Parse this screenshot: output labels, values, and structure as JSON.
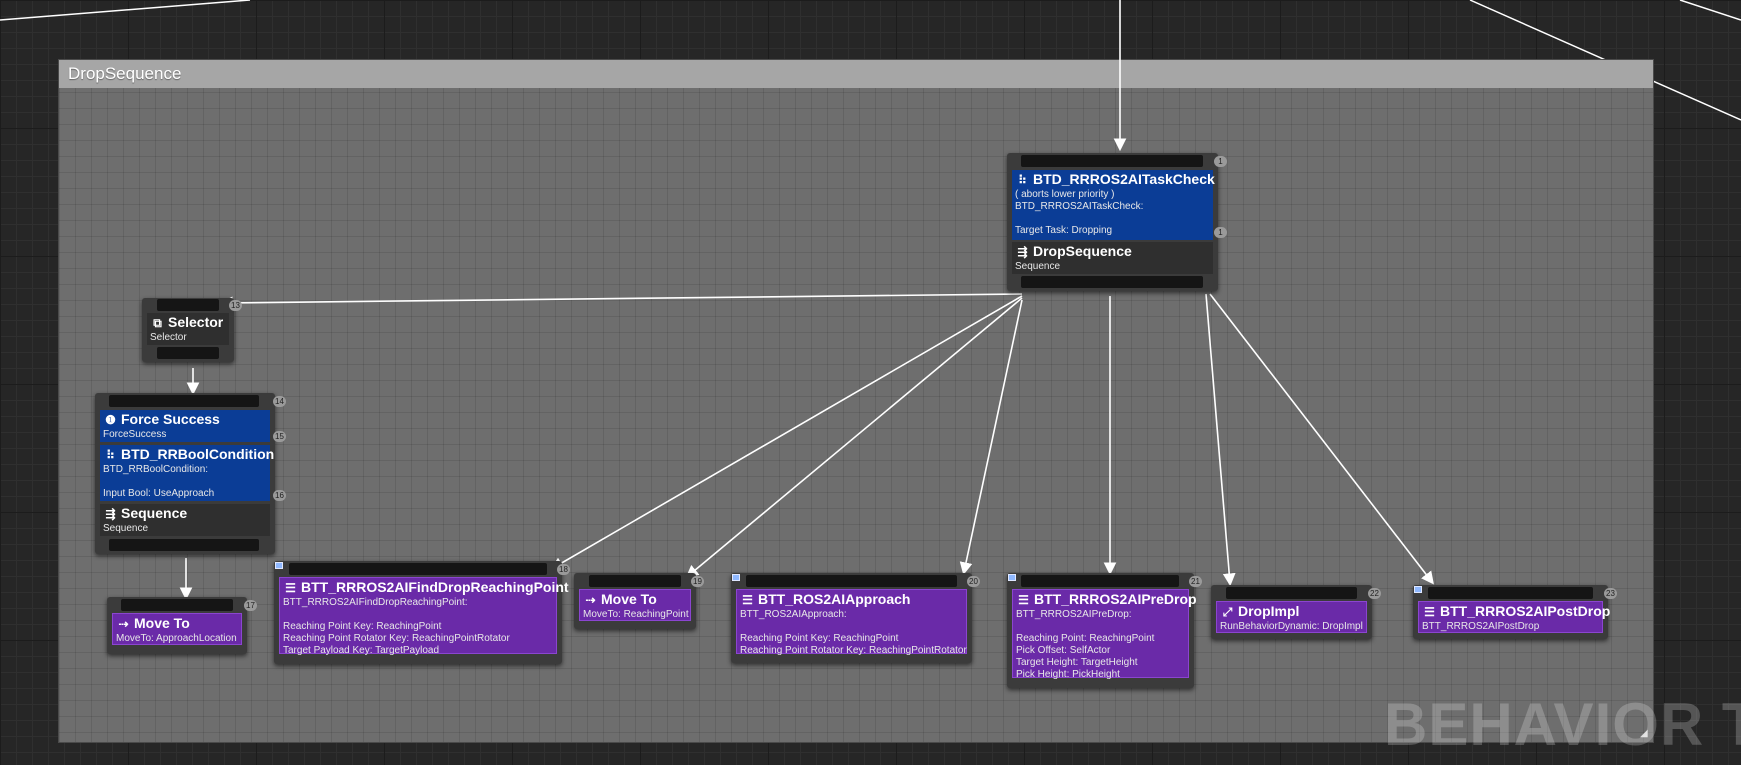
{
  "comment": {
    "title": "DropSequence"
  },
  "watermark": "BEHAVIOR TRE",
  "resize_grip": "◢",
  "colors": {
    "decorator": "#0b3d96",
    "task": "#6a2aa8",
    "composite": "#2f2f2f",
    "wire": "#ffffff"
  },
  "root": {
    "index": "1",
    "decorator": {
      "icon": "decorator-icon",
      "title": "BTD_RRROS2AITaskCheck",
      "lines": [
        "( aborts lower priority )",
        "BTD_RRROS2AITaskCheck:",
        "",
        "Target Task: Dropping"
      ],
      "index": "1"
    },
    "composite": {
      "icon": "sequence-icon",
      "title": "DropSequence",
      "subtitle": "Sequence"
    }
  },
  "selector": {
    "index": "13",
    "icon": "selector-icon",
    "title": "Selector",
    "subtitle": "Selector"
  },
  "approach_seq": {
    "index": "14",
    "dec1": {
      "title": "Force Success",
      "subtitle": "ForceSuccess",
      "index": "15"
    },
    "dec2": {
      "title": "BTD_RRBoolCondition",
      "lines": [
        "BTD_RRBoolCondition:",
        "",
        "Input Bool: UseApproach"
      ],
      "index": "16"
    },
    "composite": {
      "title": "Sequence",
      "subtitle": "Sequence"
    }
  },
  "moveto_approach": {
    "index": "17",
    "title": "Move To",
    "subtitle": "MoveTo: ApproachLocation"
  },
  "tasks": {
    "find": {
      "index": "18",
      "title": "BTT_RRROS2AIFindDropReachingPoint",
      "lines": [
        "BTT_RRROS2AIFindDropReachingPoint:",
        "",
        "Reaching Point Key: ReachingPoint",
        "Reaching Point Rotator Key: ReachingPointRotator",
        "Target Payload Key: TargetPayload"
      ]
    },
    "moveto": {
      "index": "19",
      "title": "Move To",
      "lines": [
        "MoveTo: ReachingPoint"
      ]
    },
    "approach": {
      "index": "20",
      "title": "BTT_ROS2AIApproach",
      "lines": [
        "BTT_ROS2AIApproach:",
        "",
        "Reaching Point Key: ReachingPoint",
        "Reaching Point Rotator Key: ReachingPointRotator"
      ]
    },
    "predrop": {
      "index": "21",
      "title": "BTT_RRROS2AIPreDrop",
      "lines": [
        "BTT_RRROS2AIPreDrop:",
        "",
        "Reaching Point: ReachingPoint",
        "Pick Offset: SelfActor",
        "Target Height: TargetHeight",
        "Pick Height: PickHeight"
      ]
    },
    "dropimpl": {
      "index": "22",
      "title": "DropImpl",
      "lines": [
        "RunBehaviorDynamic: DropImpl"
      ]
    },
    "postdrop": {
      "index": "23",
      "title": "BTT_RRROS2AIPostDrop",
      "lines": [
        "BTT_RRROS2AIPostDrop"
      ]
    }
  }
}
